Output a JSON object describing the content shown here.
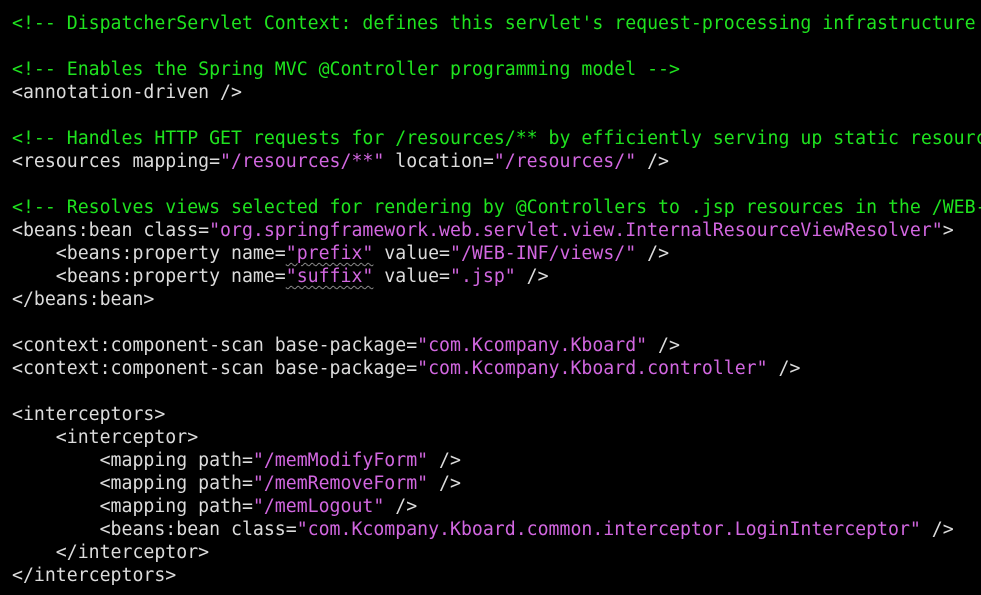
{
  "colors": {
    "background": "#000000",
    "comment": "#1fe31f",
    "tag": "#dcdcdc",
    "string": "#d267e0"
  },
  "lines": [
    {
      "tokens": [
        {
          "t": "comment",
          "v": "<!-- DispatcherServlet Context: defines this servlet's request-processing infrastructure -->"
        }
      ]
    },
    {
      "tokens": []
    },
    {
      "tokens": [
        {
          "t": "comment",
          "v": "<!-- Enables the Spring MVC @Controller programming model -->"
        }
      ]
    },
    {
      "tokens": [
        {
          "t": "tag",
          "v": "<annotation-driven />"
        }
      ]
    },
    {
      "tokens": []
    },
    {
      "tokens": [
        {
          "t": "comment",
          "v": "<!-- Handles HTTP GET requests for /resources/** by efficiently serving up static resources in the ${webappRoot}/resources directory -->"
        }
      ]
    },
    {
      "tokens": [
        {
          "t": "tag",
          "v": "<resources mapping="
        },
        {
          "t": "string",
          "v": "\"/resources/**\""
        },
        {
          "t": "tag",
          "v": " location="
        },
        {
          "t": "string",
          "v": "\"/resources/\""
        },
        {
          "t": "tag",
          "v": " />"
        }
      ]
    },
    {
      "tokens": []
    },
    {
      "tokens": [
        {
          "t": "comment",
          "v": "<!-- Resolves views selected for rendering by @Controllers to .jsp resources in the /WEB-INF/views directory -->"
        }
      ]
    },
    {
      "tokens": [
        {
          "t": "tag",
          "v": "<beans:bean class="
        },
        {
          "t": "string",
          "v": "\"org.springframework.web.servlet.view.InternalResourceViewResolver\""
        },
        {
          "t": "tag",
          "v": ">"
        }
      ]
    },
    {
      "tokens": [
        {
          "t": "tag",
          "v": "    <beans:property name="
        },
        {
          "t": "string",
          "v": "\"prefix\""
        },
        {
          "t": "tag",
          "v": " value="
        },
        {
          "t": "string",
          "v": "\"/WEB-INF/views/\""
        },
        {
          "t": "tag",
          "v": " />"
        }
      ]
    },
    {
      "tokens": [
        {
          "t": "tag",
          "v": "    <beans:property name="
        },
        {
          "t": "string",
          "v": "\"suffix\""
        },
        {
          "t": "tag",
          "v": " value="
        },
        {
          "t": "string",
          "v": "\".jsp\""
        },
        {
          "t": "tag",
          "v": " />"
        }
      ]
    },
    {
      "tokens": [
        {
          "t": "tag",
          "v": "</beans:bean>"
        }
      ]
    },
    {
      "tokens": []
    },
    {
      "tokens": [
        {
          "t": "tag",
          "v": "<context:component-scan base-package="
        },
        {
          "t": "string",
          "v": "\"com.Kcompany.Kboard\""
        },
        {
          "t": "tag",
          "v": " />"
        }
      ]
    },
    {
      "tokens": [
        {
          "t": "tag",
          "v": "<context:component-scan base-package="
        },
        {
          "t": "string",
          "v": "\"com.Kcompany.Kboard.controller\""
        },
        {
          "t": "tag",
          "v": " />"
        }
      ]
    },
    {
      "tokens": []
    },
    {
      "tokens": [
        {
          "t": "tag",
          "v": "<interceptors>"
        }
      ]
    },
    {
      "tokens": [
        {
          "t": "tag",
          "v": "    <interceptor>"
        }
      ]
    },
    {
      "tokens": [
        {
          "t": "tag",
          "v": "        <mapping path="
        },
        {
          "t": "string",
          "v": "\"/memModifyForm\""
        },
        {
          "t": "tag",
          "v": " />"
        }
      ]
    },
    {
      "tokens": [
        {
          "t": "tag",
          "v": "        <mapping path="
        },
        {
          "t": "string",
          "v": "\"/memRemoveForm\""
        },
        {
          "t": "tag",
          "v": " />"
        }
      ]
    },
    {
      "tokens": [
        {
          "t": "tag",
          "v": "        <mapping path="
        },
        {
          "t": "string",
          "v": "\"/memLogout\""
        },
        {
          "t": "tag",
          "v": " />"
        }
      ]
    },
    {
      "tokens": [
        {
          "t": "tag",
          "v": "        <beans:bean class="
        },
        {
          "t": "string",
          "v": "\"com.Kcompany.Kboard.common.interceptor.LoginInterceptor\""
        },
        {
          "t": "tag",
          "v": " />"
        }
      ]
    },
    {
      "tokens": [
        {
          "t": "tag",
          "v": "    </interceptor>"
        }
      ]
    },
    {
      "tokens": [
        {
          "t": "tag",
          "v": "</interceptors>"
        }
      ]
    }
  ]
}
